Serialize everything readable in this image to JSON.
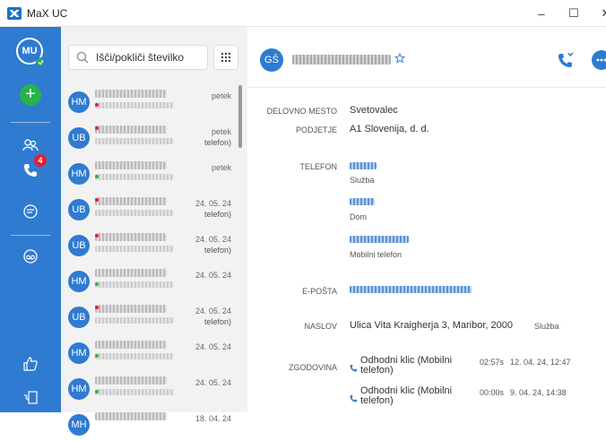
{
  "window": {
    "title": "MaX UC",
    "minimize": "–",
    "maximize": "☐",
    "close": "✕"
  },
  "rail": {
    "avatar_initials": "MU",
    "add_label": "+",
    "missed_badge": "4",
    "icons": [
      "contacts-icon",
      "calls-icon",
      "chat-icon",
      "voicemail-icon",
      "feedback-icon",
      "softphone-icon"
    ]
  },
  "search": {
    "placeholder": "Išči/pokliči številko"
  },
  "list": {
    "items": [
      {
        "initials": "HM",
        "date": "petek",
        "tail": ""
      },
      {
        "initials": "UB",
        "date": "petek",
        "tail": "telefon)"
      },
      {
        "initials": "HM",
        "date": "petek",
        "tail": ""
      },
      {
        "initials": "UB",
        "date": "24. 05. 24",
        "tail": "telefon)"
      },
      {
        "initials": "UB",
        "date": "24. 05. 24",
        "tail": "telefon)"
      },
      {
        "initials": "HM",
        "date": "24. 05. 24",
        "tail": ""
      },
      {
        "initials": "UB",
        "date": "24. 05. 24",
        "tail": "telefon)"
      },
      {
        "initials": "HM",
        "date": "24. 05. 24",
        "tail": ""
      },
      {
        "initials": "HM",
        "date": "24. 05. 24",
        "tail": ""
      },
      {
        "initials": "MH",
        "date": "18. 04. 24",
        "tail": ""
      }
    ]
  },
  "contact": {
    "initials": "GŠ",
    "fields": {
      "workplace_label": "DELOVNO MESTO",
      "workplace": "Svetovalec",
      "company_label": "PODJETJE",
      "company": "A1 Slovenija, d. d.",
      "phone_label": "TELEFON",
      "phone_types": [
        "Služba",
        "Dom",
        "Mobilni telefon"
      ],
      "email_label": "E-POŠTA",
      "address_label": "NASLOV",
      "address": "Ulica Vita Kraigherja 3, Maribor, 2000",
      "address_type": "Služba",
      "history_label": "ZGODOVINA"
    },
    "history": [
      {
        "text": "Odhodni klic (Mobilni telefon)",
        "duration": "02:57s",
        "time": "12. 04. 24, 12:47"
      },
      {
        "text": "Odhodni klic (Mobilni telefon)",
        "duration": "00:00s",
        "time": "9. 04. 24, 14:38"
      }
    ]
  },
  "colors": {
    "brand": "#2f7bd1",
    "online": "#2bb34a",
    "badge": "#e0202f"
  }
}
